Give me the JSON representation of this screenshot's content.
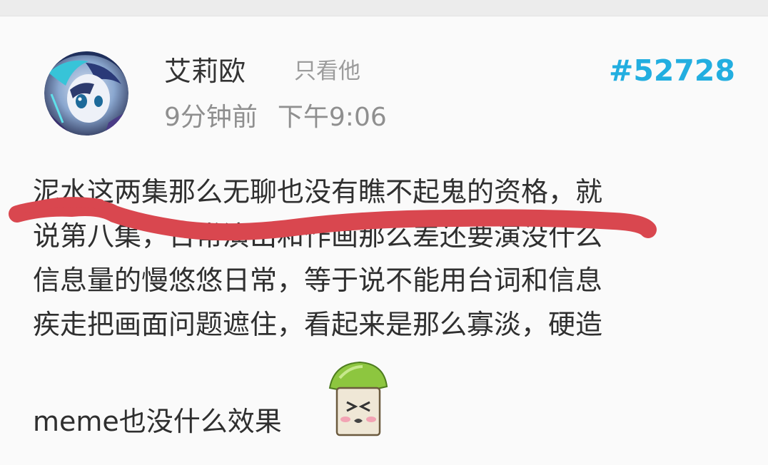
{
  "post": {
    "username": "艾莉欧",
    "only_him_label": "只看他",
    "floor_number": "#52728",
    "relative_time": "9分钟前",
    "clock_time": "下午9:06",
    "body_lines": [
      "泥水这两集那么无聊也没有瞧不起鬼的资格，就",
      "说第八集，日常演出和作画那么差还要演没什么",
      "信息量的慢悠悠日常，等于说不能用台词和信息",
      "疾走把画面问题遮住，看起来是那么寡淡，硬造"
    ],
    "last_line_text": "meme也没什么效果",
    "emoticon_icon": "mushroom-face-emoticon"
  },
  "colors": {
    "floor_accent": "#22aee0",
    "strike_red": "#d9474f",
    "username_text": "#333333",
    "meta_gray": "#8f8f8f"
  },
  "icons": {
    "avatar": "anime-avatar-icon",
    "emoticon": "mushroom-emoticon-icon"
  }
}
